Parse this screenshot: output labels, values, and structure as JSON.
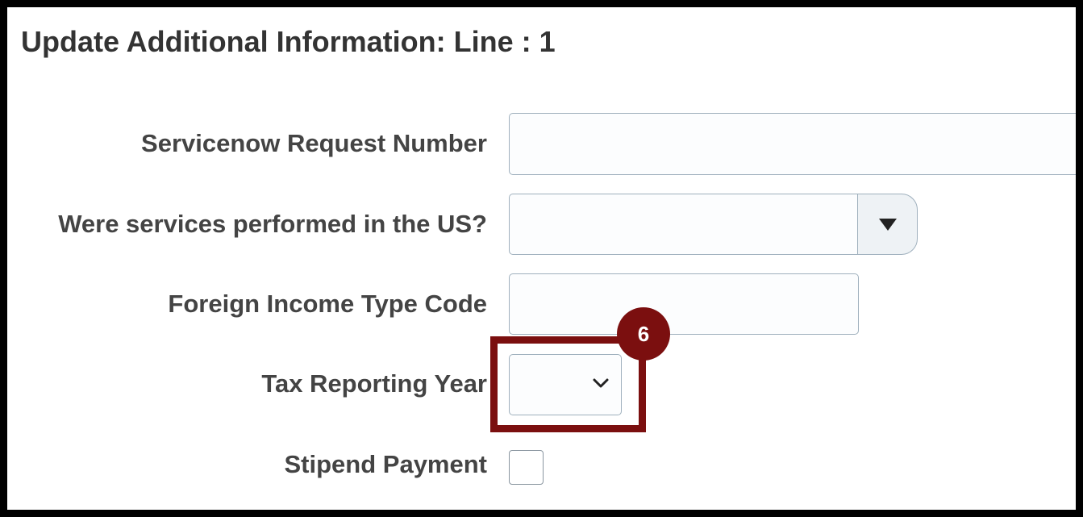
{
  "page": {
    "title": "Update Additional Information: Line : 1"
  },
  "form": {
    "servicenow_label": "Servicenow Request Number",
    "servicenow_value": "",
    "us_services_label": "Were services performed in the US?",
    "us_services_value": "",
    "foreign_income_label": "Foreign Income Type Code",
    "foreign_income_value": "",
    "tax_year_label": "Tax Reporting Year",
    "tax_year_value": "",
    "stipend_label": "Stipend Payment",
    "stipend_checked": false
  },
  "callout": {
    "step_number": "6",
    "color": "#7b0f0f"
  },
  "icons": {
    "dropdown": "triangle-down-icon",
    "select": "chevron-down-icon"
  }
}
